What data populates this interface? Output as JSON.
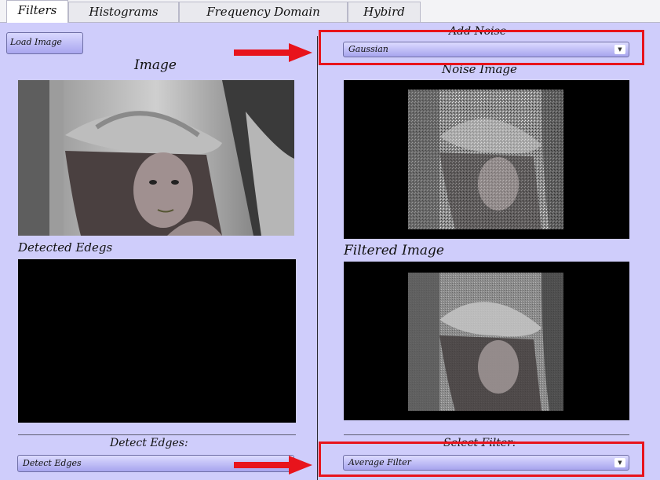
{
  "tabs": [
    {
      "label": "Filters",
      "active": true
    },
    {
      "label": "Histograms",
      "active": false
    },
    {
      "label": "Frequency Domain",
      "active": false
    },
    {
      "label": "Hybird",
      "active": false
    }
  ],
  "left": {
    "load_button": "Load Image",
    "image_title": "Image",
    "edges_title": "Detected Edegs",
    "detect_title": "Detect Edges:",
    "detect_combo": "Detect Edges"
  },
  "right": {
    "noise_title": "Add Noise",
    "noise_combo": "Gaussian",
    "noise_image_title": "Noise Image",
    "filtered_title": "Filtered Image",
    "filter_title": "Select Filter:",
    "filter_combo": "Average Filter"
  },
  "colors": {
    "panel_bg": "#cfcdfb",
    "highlight": "#e8141c"
  }
}
